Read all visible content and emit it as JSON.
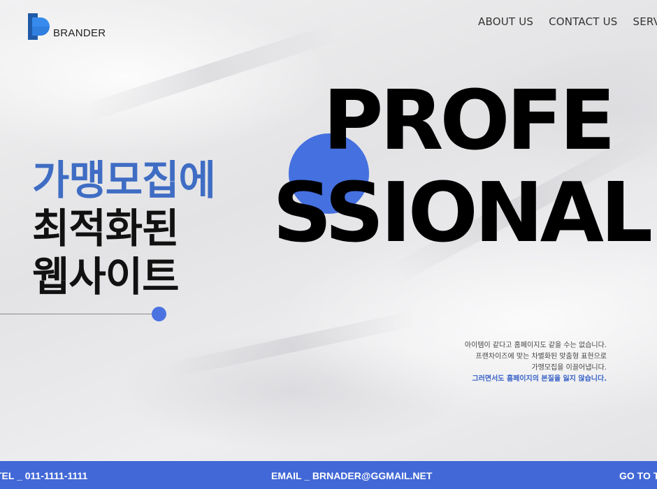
{
  "brand": {
    "name": "BRANDER"
  },
  "nav": {
    "items": [
      "ABOUT US",
      "CONTACT US",
      "SERVICE"
    ]
  },
  "hero": {
    "kr_line1": "가맹모집에",
    "kr_line2": "최적화된",
    "kr_line3": "웹사이트",
    "big_line1": "PROFE",
    "big_line2": "SSIONAL"
  },
  "description": {
    "line1": "아이템이 같다고 홈페이지도 같을 수는 없습니다.",
    "line2": "프랜차이즈에 맞는 차별화된 맞춤형 표현으로",
    "line3": "가맹모집을 이끌어냅니다.",
    "highlight": "그러면서도 홈페이지의 본질을 잃지 않습니다."
  },
  "footer": {
    "tel": "TEL _ 011-1111-1111",
    "email": "EMAIL _ BRNADER@GGMAIL.NET",
    "top": "GO TO TOP"
  },
  "colors": {
    "accent": "#4570df",
    "headline_blue": "#3f6dc4",
    "footer_bg": "#4168d6"
  }
}
